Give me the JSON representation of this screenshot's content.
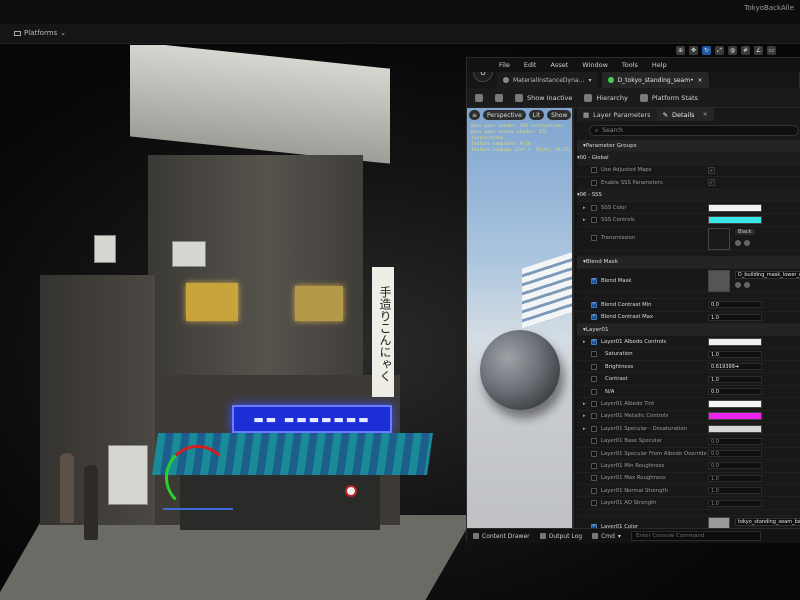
{
  "window": {
    "project_name": "TokyoBackAlle"
  },
  "toolbar": {
    "platforms_label": "Platforms"
  },
  "scene": {
    "vertical_sign_text": "手造りこんにゃく",
    "blue_sign_text": "▬▬ ▬▬▬▬▬▬▬"
  },
  "material_editor": {
    "logo": "U",
    "menu": [
      "File",
      "Edit",
      "Asset",
      "Window",
      "Tools",
      "Help"
    ],
    "tabs": [
      {
        "label": "MaterialInstanceDyna…"
      },
      {
        "label": "D_tokyo_standing_seam•"
      }
    ],
    "tools": {
      "save_icon": "save-icon",
      "browse_icon": "folder-icon",
      "show_inactive": "Show Inactive",
      "hierarchy": "Hierarchy",
      "platform_stats": "Platform Stats"
    },
    "preview": {
      "perspective": "Perspective",
      "lit": "Lit",
      "show": "Show",
      "stats": [
        "Base pass shader: 339 instructions",
        "Base pass vertex shader: 272 instructions",
        "Texture samplers: 9/16",
        "Texture Lookups (Est.): VS(4), PS(27)"
      ]
    },
    "details": {
      "tab_layer_params": "Layer Parameters",
      "tab_details": "Details",
      "search_placeholder": "Search",
      "rows": [
        {
          "kind": "group",
          "label": "Parameter Groups"
        },
        {
          "kind": "sub",
          "label": "00 - Global"
        },
        {
          "kind": "param",
          "label": "Use Adjusted Maps",
          "checked": false,
          "right": "check"
        },
        {
          "kind": "param",
          "label": "Enable SSS Parameters",
          "checked": false,
          "right": "check"
        },
        {
          "kind": "sub",
          "label": "06 - SSS"
        },
        {
          "kind": "param",
          "label": "SSS Color",
          "checked": false,
          "expand": true,
          "swatch": "#f2f2f2"
        },
        {
          "kind": "param",
          "label": "SSS Controls",
          "checked": false,
          "expand": true,
          "swatch": "#38e8e8"
        },
        {
          "kind": "param",
          "label": "Transmission",
          "checked": false,
          "texture": "#1a1a1a",
          "dropdown": "Black"
        },
        {
          "kind": "spacer"
        },
        {
          "kind": "group",
          "label": "Blend Mask"
        },
        {
          "kind": "param",
          "label": "Blend Mask",
          "checked": true,
          "on": true,
          "texture": "#555",
          "texname": "D_building_mask_lower_mo"
        },
        {
          "kind": "spacer"
        },
        {
          "kind": "param",
          "label": "Blend Contrast Min",
          "checked": true,
          "on": true,
          "value": "0.0"
        },
        {
          "kind": "param",
          "label": "Blend Contrast Max",
          "checked": true,
          "on": true,
          "value": "1.0"
        },
        {
          "kind": "group",
          "label": "Layer01"
        },
        {
          "kind": "param",
          "label": "Layer01 Albedo Controls",
          "checked": true,
          "on": true,
          "expand": true,
          "swatch": "#f0f0f0"
        },
        {
          "kind": "param",
          "label": "Saturation",
          "checked": false,
          "on": true,
          "indent": true,
          "value": "1.0"
        },
        {
          "kind": "param",
          "label": "Brightness",
          "checked": false,
          "on": true,
          "indent": true,
          "value": "0.619399➔"
        },
        {
          "kind": "param",
          "label": "Contrast",
          "checked": false,
          "on": true,
          "indent": true,
          "value": "1.0"
        },
        {
          "kind": "param",
          "label": "N/A",
          "checked": false,
          "on": true,
          "indent": true,
          "value": "0.0"
        },
        {
          "kind": "param",
          "label": "Layer01 Albedo Tint",
          "checked": false,
          "expand": true,
          "swatch": "#f4f4f4"
        },
        {
          "kind": "param",
          "label": "Layer01 Metallic Controls",
          "checked": false,
          "expand": true,
          "swatch": "#ee22ee"
        },
        {
          "kind": "param",
          "label": "Layer01 Specular - Desaturation",
          "checked": false,
          "expand": true,
          "swatch": "#d8d8d8"
        },
        {
          "kind": "param",
          "label": "Layer01 Base Specular",
          "checked": false,
          "value": "0.0",
          "dim": true
        },
        {
          "kind": "param",
          "label": "Layer01 Specular From Albedo Override",
          "checked": false,
          "value": "0.0",
          "dim": true
        },
        {
          "kind": "param",
          "label": "Layer01 Min Roughness",
          "checked": false,
          "value": "0.0",
          "dim": true
        },
        {
          "kind": "param",
          "label": "Layer01 Max Roughness",
          "checked": false,
          "value": "1.0",
          "dim": true
        },
        {
          "kind": "param",
          "label": "Layer01 Normal Strength",
          "checked": false,
          "value": "1.0",
          "dim": true
        },
        {
          "kind": "param",
          "label": "Layer01 AO Strength",
          "checked": false,
          "value": "1.0",
          "dim": true
        },
        {
          "kind": "spacer"
        },
        {
          "kind": "param",
          "label": "Layer01 Color",
          "checked": true,
          "on": true,
          "texture": "#9a9a9a",
          "texname": "tokyo_standing_seam_baseC"
        }
      ]
    },
    "bottom": {
      "content_drawer": "Content Drawer",
      "output_log": "Output Log",
      "cmd": "Cmd",
      "console_placeholder": "Enter Console Command"
    }
  }
}
